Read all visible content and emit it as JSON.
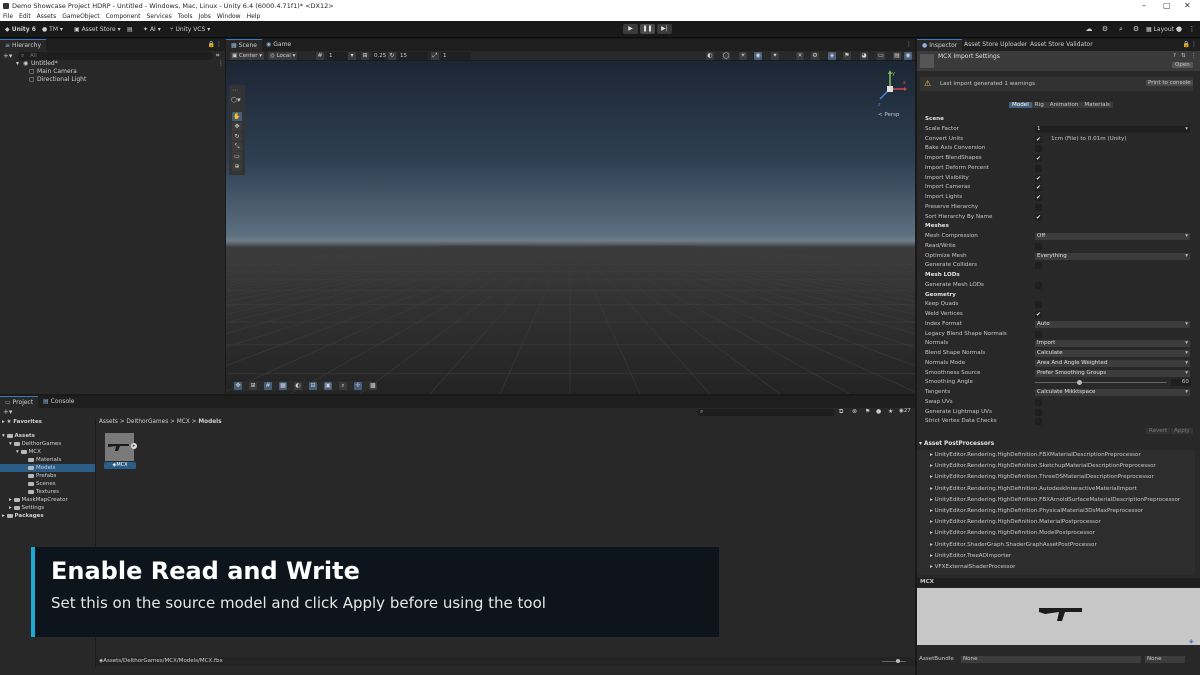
{
  "window": {
    "title": "Demo Showcase Project HDRP - Untitled - Windows, Mac, Linux - Unity 6.4 (6000.4.71f1)* <DX12>"
  },
  "menu": [
    "File",
    "Edit",
    "Assets",
    "GameObject",
    "Component",
    "Services",
    "Tools",
    "Jobs",
    "Window",
    "Help"
  ],
  "toolbar": {
    "unity": "Unity 6",
    "account": "TM",
    "asset_store": "Asset Store",
    "ai": "AI",
    "vcs": "Unity VCS",
    "layout": "Layout"
  },
  "hierarchy": {
    "tab": "Hierarchy",
    "search_placeholder": "All",
    "scene": "Untitled*",
    "items": [
      "Main Camera",
      "Directional Light"
    ]
  },
  "scene": {
    "tabs": [
      "Scene",
      "Game"
    ],
    "pivot": "Center",
    "space": "Local",
    "grid_value": "1",
    "snap_value": "0.25",
    "angle": "15",
    "scale_snap": "1",
    "persp": "< Persp",
    "gizmo_axes": [
      "y",
      "x",
      "z"
    ]
  },
  "project": {
    "tabs": [
      "Project",
      "Console"
    ],
    "favorites": "Favorites",
    "breadcrumb": [
      "Assets",
      "DelthorGames",
      "MCX",
      "Models"
    ],
    "tree": [
      "Assets",
      "DelthorGames",
      "MCX",
      "Materials",
      "Models",
      "Prefabs",
      "Scenes",
      "Textures",
      "MaskMapCreator",
      "Settings",
      "Packages"
    ],
    "asset_name": "MCX",
    "count": "27",
    "footer_path": "Assets/DelthorGames/MCX/Models/MCX.fbx"
  },
  "overlay": {
    "title": "Enable Read and Write",
    "subtitle": "Set this on the source model and click Apply before using the tool"
  },
  "inspector": {
    "tabs": [
      "Inspector",
      "Asset Store Uploader",
      "Asset Store Validator"
    ],
    "header": "MCX Import Settings",
    "open": "Open",
    "warning": "Last import generated 1 warnings",
    "print": "Print to console",
    "subtabs": [
      "Model",
      "Rig",
      "Animation",
      "Materials"
    ],
    "rows": [
      {
        "label": "Scene",
        "kind": "section"
      },
      {
        "label": "Scale Factor",
        "kind": "field",
        "value": "1"
      },
      {
        "label": "Convert Units",
        "kind": "check",
        "value": "✔",
        "extra": "1cm (File) to 0.01m (Unity)"
      },
      {
        "label": "Bake Axis Conversion",
        "kind": "check",
        "value": ""
      },
      {
        "label": "Import BlendShapes",
        "kind": "check",
        "value": "✔"
      },
      {
        "label": "Import Deform Percent",
        "kind": "check",
        "value": ""
      },
      {
        "label": "Import Visibility",
        "kind": "check",
        "value": "✔"
      },
      {
        "label": "Import Cameras",
        "kind": "check",
        "value": "✔"
      },
      {
        "label": "Import Lights",
        "kind": "check",
        "value": "✔"
      },
      {
        "label": "Preserve Hierarchy",
        "kind": "check",
        "value": ""
      },
      {
        "label": "Sort Hierarchy By Name",
        "kind": "check",
        "value": "✔"
      },
      {
        "label": "Meshes",
        "kind": "section"
      },
      {
        "label": "Mesh Compression",
        "kind": "dropdown",
        "value": "Off"
      },
      {
        "label": "Read/Write",
        "kind": "check",
        "value": ""
      },
      {
        "label": "Optimize Mesh",
        "kind": "dropdown",
        "value": "Everything"
      },
      {
        "label": "Generate Colliders",
        "kind": "check",
        "value": ""
      },
      {
        "label": "Mesh LODs",
        "kind": "section"
      },
      {
        "label": "Generate Mesh LODs",
        "kind": "check",
        "value": ""
      },
      {
        "label": "Geometry",
        "kind": "section"
      },
      {
        "label": "Keep Quads",
        "kind": "check",
        "value": ""
      },
      {
        "label": "Weld Vertices",
        "kind": "check",
        "value": "✔"
      },
      {
        "label": "Index Format",
        "kind": "dropdown",
        "value": "Auto"
      },
      {
        "label": "Legacy Blend Shape Normals",
        "kind": "check",
        "value": ""
      },
      {
        "label": "Normals",
        "kind": "dropdown",
        "value": "Import"
      },
      {
        "label": "Blend Shape Normals",
        "kind": "dropdown",
        "value": "Calculate"
      },
      {
        "label": "Normals Mode",
        "kind": "dropdown",
        "value": "Area And Angle Weighted"
      },
      {
        "label": "Smoothness Source",
        "kind": "dropdown",
        "value": "Prefer Smoothing Groups"
      },
      {
        "label": "Smoothing Angle",
        "kind": "slider",
        "value": "60"
      },
      {
        "label": "Tangents",
        "kind": "dropdown",
        "value": "Calculate Mikktspace"
      },
      {
        "label": "Swap UVs",
        "kind": "check",
        "value": ""
      },
      {
        "label": "Generate Lightmap UVs",
        "kind": "check",
        "value": ""
      },
      {
        "label": "Strict Vertex Data Checks",
        "kind": "check",
        "value": ""
      }
    ],
    "smoothing_fraction": 0.333,
    "revert": "Revert",
    "apply": "Apply",
    "postprocessors_title": "Asset PostProcessors",
    "postprocessors": [
      "UnityEditor.Rendering.HighDefinition.FBXMaterialDescriptionPreprocessor",
      "UnityEditor.Rendering.HighDefinition.SketchupMaterialDescriptionPreprocessor",
      "UnityEditor.Rendering.HighDefinition.ThreeDSMaterialDescriptionPreprocessor",
      "UnityEditor.Rendering.HighDefinition.AutodeskInteractiveMaterialImport",
      "UnityEditor.Rendering.HighDefinition.FBXArnoldSurfaceMaterialDescriptionPreprocessor",
      "UnityEditor.Rendering.HighDefinition.PhysicalMaterial3DsMaxPreprocessor",
      "UnityEditor.Rendering.HighDefinition.MaterialPostprocessor",
      "UnityEditor.Rendering.HighDefinition.ModelPostprocessor",
      "UnityEditor.ShaderGraph.ShaderGraphAssetPostProcessor",
      "UnityEditor.TreeAOImporter",
      "VFXExternalShaderProcessor"
    ],
    "preview_title": "MCX",
    "assetbundle_label": "AssetBundle",
    "assetbundle_value": "None",
    "assetbundle_variant": "None"
  }
}
